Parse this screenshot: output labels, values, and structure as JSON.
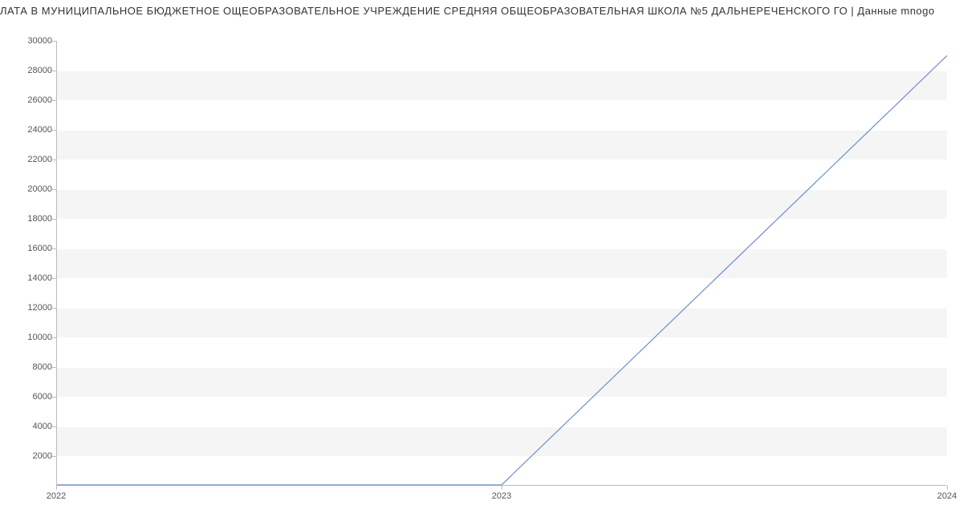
{
  "title": "ЛАТА В МУНИЦИПАЛЬНОЕ БЮДЖЕТНОЕ ОЩЕОБРАЗОВАТЕЛЬНОЕ УЧРЕЖДЕНИЕ СРЕДНЯЯ ОБЩЕОБРАЗОВАТЕЛЬНАЯ ШКОЛА №5 ДАЛЬНЕРЕЧЕНСКОГО ГО | Данные mnogo",
  "chart_data": {
    "type": "line",
    "x": [
      2022,
      2023,
      2024
    ],
    "values": [
      0,
      0,
      29000
    ],
    "title": "ЛАТА В МУНИЦИПАЛЬНОЕ БЮДЖЕТНОЕ ОЩЕОБРАЗОВАТЕЛЬНОЕ УЧРЕЖДЕНИЕ СРЕДНЯЯ ОБЩЕОБРАЗОВАТЕЛЬНАЯ ШКОЛА №5 ДАЛЬНЕРЕЧЕНСКОГО ГО | Данные mnogo",
    "xlabel": "",
    "ylabel": "",
    "xlim": [
      2022,
      2024
    ],
    "ylim": [
      0,
      30000
    ],
    "y_ticks": [
      2000,
      4000,
      6000,
      8000,
      10000,
      12000,
      14000,
      16000,
      18000,
      20000,
      22000,
      24000,
      26000,
      28000,
      30000
    ],
    "x_ticks": [
      2022,
      2023,
      2024
    ]
  }
}
